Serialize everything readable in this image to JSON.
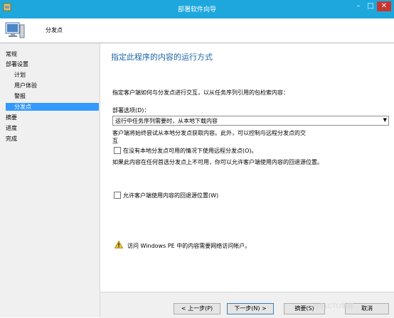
{
  "window": {
    "title": "部署软件向导"
  },
  "header": {
    "title": "分发点"
  },
  "sidebar": {
    "items": [
      {
        "label": "常规"
      },
      {
        "label": "部署设置"
      },
      {
        "label": "计划"
      },
      {
        "label": "用户体验"
      },
      {
        "label": "警报"
      },
      {
        "label": "分发点",
        "selected": true
      },
      {
        "label": "摘要"
      },
      {
        "label": "进度"
      },
      {
        "label": "完成"
      }
    ]
  },
  "main": {
    "heading": "指定此程序的内容的运行方式",
    "intro": "指定客户端如何与分发点进行交互，以从任务序列引用的包检索内容：",
    "deployment_options_label": "部署选项(D)：",
    "deployment_option_value": "运行中任务序列需要时，从本地下载内容",
    "fallback_description_line1": "客户端将始终尝试从本地分发点获取内容。此外，可以控制与远程分发点的交",
    "fallback_description_line2": "互",
    "remote_dp_checkbox_label": "在没有本地分发点可用的情况下使用远程分发点(O)。",
    "fallback_note": "如果此内容在任何首选分发点上不可用，你可以允许客户端使用内容的回退源位置。",
    "fallback_source_checkbox_label": "允许客户端使用内容的回退源位置(W)",
    "warning_text": "访问 Windows PE 中的内容需要网络访问帐户。"
  },
  "footer": {
    "back_label": "< 上一步(P)",
    "next_label": "下一步(N) >",
    "summary_label": "摘要(S)",
    "cancel_label": "取消"
  },
  "watermark": "@51CTO博客",
  "colors": {
    "titlebar": "#1ea7dd",
    "heading": "#1c64a8",
    "selection": "#3399ff"
  }
}
